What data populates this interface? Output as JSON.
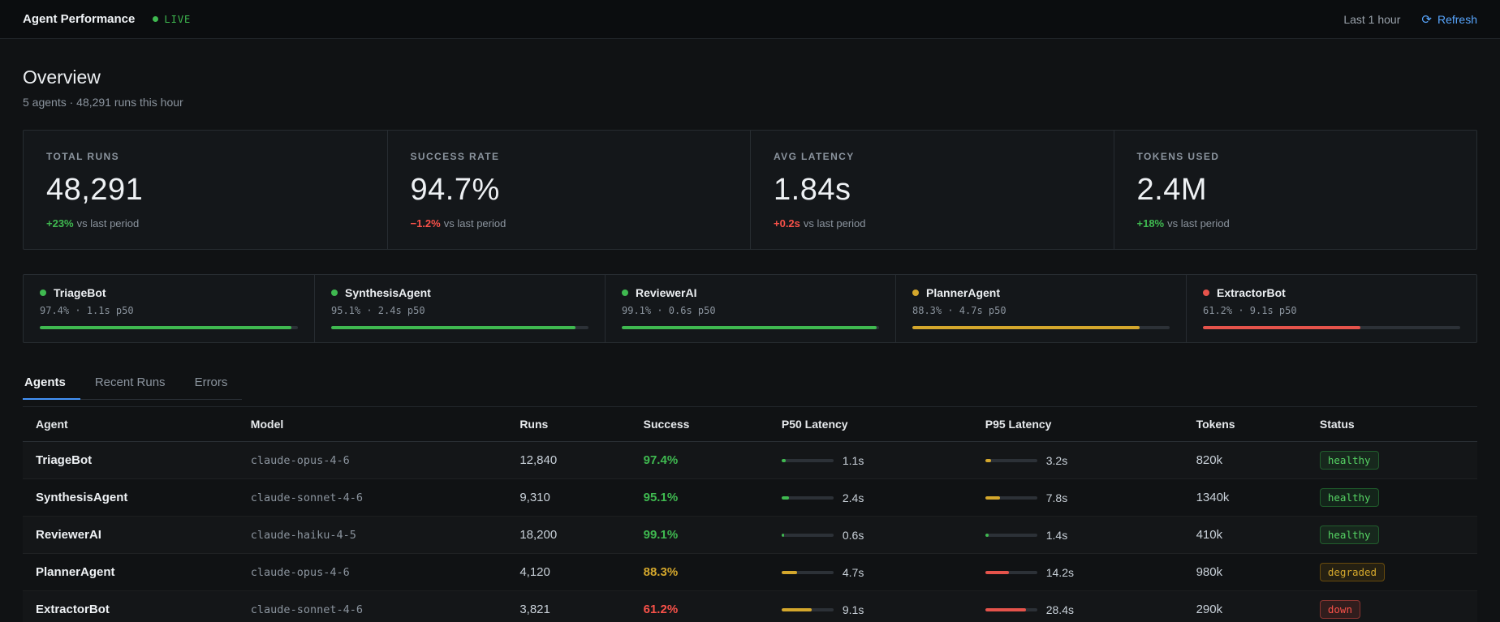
{
  "colors": {
    "green": "#3fb950",
    "yellow": "#d4a72c",
    "red": "#e5534b",
    "blue": "#58a6ff"
  },
  "header": {
    "title": "Agent Performance",
    "live_label": "LIVE",
    "time_range": "Last 1 hour",
    "refresh_icon": "⟳",
    "refresh_label": "Refresh"
  },
  "overview": {
    "title": "Overview",
    "subtitle": "5 agents · 48,291 runs this hour"
  },
  "stats": [
    {
      "label": "TOTAL RUNS",
      "value": "48,291",
      "delta": "+23%",
      "suffix": "vs last period",
      "delta_color": "green"
    },
    {
      "label": "SUCCESS RATE",
      "value": "94.7%",
      "delta": "−1.2%",
      "suffix": "vs last period",
      "delta_color": "red"
    },
    {
      "label": "AVG LATENCY",
      "value": "1.84s",
      "delta": "+0.2s",
      "suffix": "vs last period",
      "delta_color": "red"
    },
    {
      "label": "TOKENS USED",
      "value": "2.4M",
      "delta": "+18%",
      "suffix": "vs last period",
      "delta_color": "green"
    }
  ],
  "agent_cards": [
    {
      "name": "TriageBot",
      "stats": "97.4% · 1.1s p50",
      "color": "green",
      "bar": {
        "pct": 97.4,
        "color": "green"
      }
    },
    {
      "name": "SynthesisAgent",
      "stats": "95.1% · 2.4s p50",
      "color": "green",
      "bar": {
        "pct": 95.1,
        "color": "green"
      }
    },
    {
      "name": "ReviewerAI",
      "stats": "99.1% · 0.6s p50",
      "color": "green",
      "bar": {
        "pct": 99.1,
        "color": "green"
      }
    },
    {
      "name": "PlannerAgent",
      "stats": "88.3% · 4.7s p50",
      "color": "yellow",
      "bar": {
        "pct": 88.3,
        "color": "yellow"
      }
    },
    {
      "name": "ExtractorBot",
      "stats": "61.2% · 9.1s p50",
      "color": "red",
      "bar": {
        "pct": 61.2,
        "color": "red"
      }
    }
  ],
  "tabs": [
    {
      "label": "Agents",
      "active": true
    },
    {
      "label": "Recent Runs",
      "active": false
    },
    {
      "label": "Errors",
      "active": false
    }
  ],
  "table": {
    "columns": [
      "Agent",
      "Model",
      "Runs",
      "Success",
      "P50 Latency",
      "P95 Latency",
      "Tokens",
      "Status"
    ],
    "rows": [
      {
        "agent": "TriageBot",
        "model": "claude-opus-4-6",
        "runs": "12,840",
        "success": "97.4%",
        "success_color": "green",
        "p50": {
          "value": "1.1s",
          "pct": 8,
          "color": "green"
        },
        "p95": {
          "value": "3.2s",
          "pct": 12,
          "color": "yellow"
        },
        "tokens": "820k",
        "status": "healthy"
      },
      {
        "agent": "SynthesisAgent",
        "model": "claude-sonnet-4-6",
        "runs": "9,310",
        "success": "95.1%",
        "success_color": "green",
        "p50": {
          "value": "2.4s",
          "pct": 14,
          "color": "green"
        },
        "p95": {
          "value": "7.8s",
          "pct": 28,
          "color": "yellow"
        },
        "tokens": "1340k",
        "status": "healthy"
      },
      {
        "agent": "ReviewerAI",
        "model": "claude-haiku-4-5",
        "runs": "18,200",
        "success": "99.1%",
        "success_color": "green",
        "p50": {
          "value": "0.6s",
          "pct": 5,
          "color": "green"
        },
        "p95": {
          "value": "1.4s",
          "pct": 6,
          "color": "green"
        },
        "tokens": "410k",
        "status": "healthy"
      },
      {
        "agent": "PlannerAgent",
        "model": "claude-opus-4-6",
        "runs": "4,120",
        "success": "88.3%",
        "success_color": "yellow",
        "p50": {
          "value": "4.7s",
          "pct": 30,
          "color": "yellow"
        },
        "p95": {
          "value": "14.2s",
          "pct": 46,
          "color": "red"
        },
        "tokens": "980k",
        "status": "degraded"
      },
      {
        "agent": "ExtractorBot",
        "model": "claude-sonnet-4-6",
        "runs": "3,821",
        "success": "61.2%",
        "success_color": "red",
        "p50": {
          "value": "9.1s",
          "pct": 58,
          "color": "yellow"
        },
        "p95": {
          "value": "28.4s",
          "pct": 78,
          "color": "red"
        },
        "tokens": "290k",
        "status": "down"
      }
    ]
  }
}
